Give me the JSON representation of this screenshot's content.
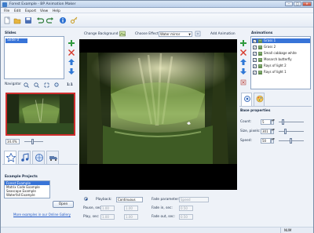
{
  "window": {
    "title": "Forest Example - BP Animation Maker"
  },
  "menu": [
    "File",
    "Edit",
    "Export",
    "View",
    "Help"
  ],
  "slides": {
    "label": "Slides",
    "items": [
      "Slide 0"
    ]
  },
  "navigator": {
    "label": "Navigator",
    "fit_label": "1:1",
    "zoom_value": "34.4%"
  },
  "projects": {
    "label": "Example Projects",
    "items": [
      "Forest Example",
      "Matrix Code Example",
      "Seascape Example",
      "Waterfall Example"
    ],
    "selected_index": 0,
    "open_label": "Open",
    "gallery_link": "More examples in our Online Gallery"
  },
  "center": {
    "change_background": "Change Background",
    "choose_effect_label": "Choose Effect:",
    "effect_value": "Water mirror",
    "add_animation": "Add Animation"
  },
  "playback": {
    "label": "Playback:",
    "mode": "Continuous",
    "fade_param_label": "Fade parameter:",
    "fade_param_value": "Speed",
    "pause_label": "Pause, sec:",
    "pause_from": "1.00",
    "pause_to": "1.00",
    "fade_in_label": "Fade in, sec:",
    "fade_in_value": "0.50",
    "play_label": "Play, sec:",
    "play_from": "1.00",
    "play_to": "1.00",
    "fade_out_label": "Fade out, sec:",
    "fade_out_value": "0.50"
  },
  "animations": {
    "label": "Animations",
    "items": [
      "Grass 1",
      "Grass 2",
      "Small cabbage white",
      "Monarch butterfly",
      "Rays of light 2",
      "Rays of light 1"
    ],
    "selected_index": 0
  },
  "base_properties": {
    "label": "Base properties",
    "count_label": "Count:",
    "count_value": "5",
    "size_label": "Size, pixels:",
    "size_value": "301",
    "speed_label": "Speed:",
    "speed_value": "50"
  },
  "status": {
    "num": "NUM"
  },
  "colors": {
    "accent": "#3874d8",
    "selection_border": "#cf2e2e"
  }
}
